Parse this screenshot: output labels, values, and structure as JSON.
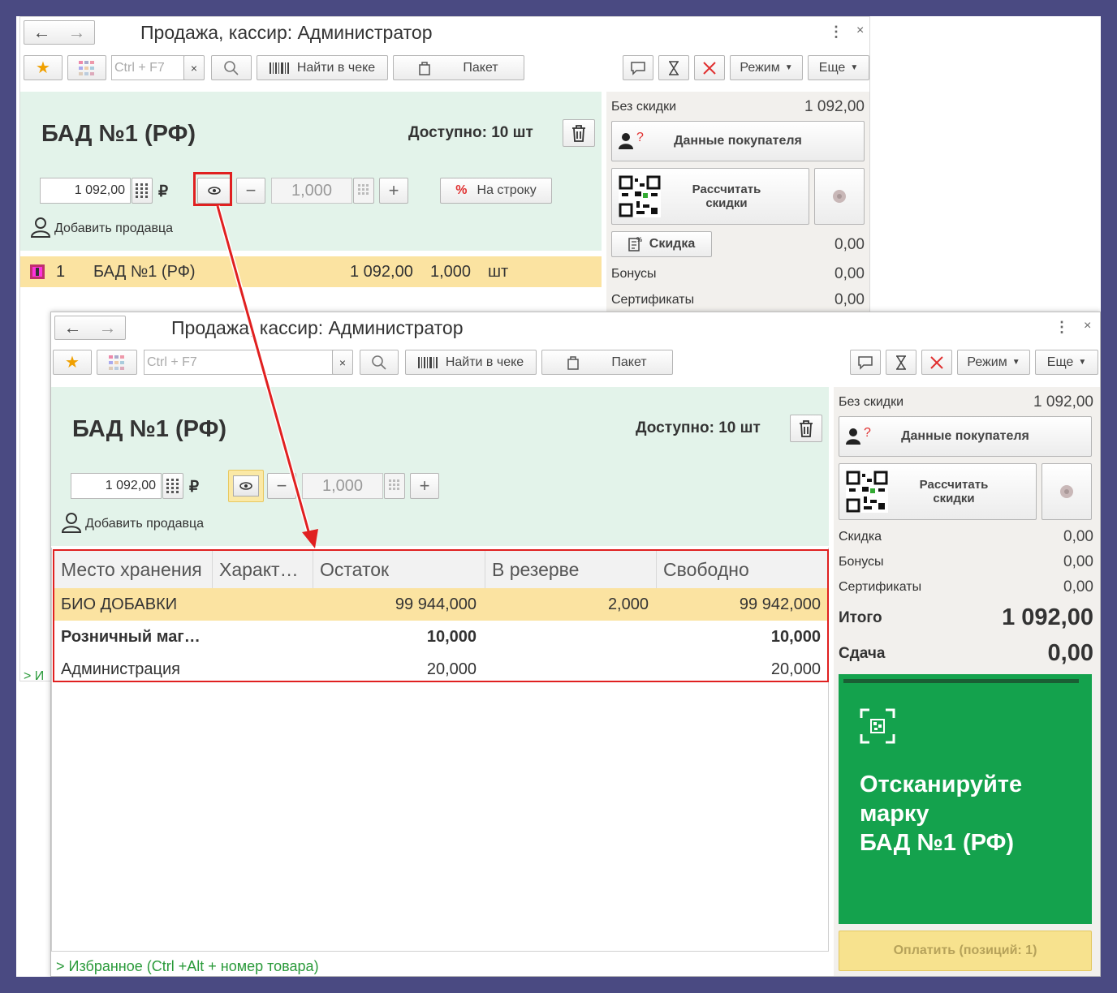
{
  "window": {
    "title": "Продажа, кассир: Администратор"
  },
  "toolbar": {
    "search_placeholder": "Ctrl + F7",
    "clear_label": "×",
    "find_in_receipt_label": "Найти в чеке",
    "package_label": "Пакет",
    "mode_label": "Режим",
    "more_label": "Еще",
    "more_menu": "⋮",
    "close": "×"
  },
  "product": {
    "name": "БАД №1 (РФ)",
    "available": "Доступно: 10 шт",
    "price": "1 092,00",
    "currency": "₽",
    "quantity": "1,000",
    "add_seller": "Добавить продавца",
    "per_line_label": "На строку",
    "percent_symbol": "%"
  },
  "receipt_line": {
    "index": "1",
    "name": "БАД №1 (РФ)",
    "price": "1 092,00",
    "qty": "1,000",
    "unit": "шт"
  },
  "summary": {
    "no_discount_label": "Без скидки",
    "no_discount_value": "1 092,00",
    "customer_data_label": "Данные покупателя",
    "calc_discounts_line1": "Рассчитать",
    "calc_discounts_line2": "скидки",
    "discount_label": "Скидка",
    "discount_value": "0,00",
    "bonuses_label": "Бонусы",
    "bonuses_value": "0,00",
    "certificates_label": "Сертификаты",
    "certificates_value": "0,00",
    "total_label": "Итого",
    "total_value": "1 092,00",
    "change_label": "Сдача",
    "change_value": "0,00"
  },
  "stock_table": {
    "headers": [
      "Место хранения",
      "Характ…",
      "Остаток",
      "В резерве",
      "Свободно"
    ],
    "rows": [
      {
        "place": "БИО ДОБАВКИ",
        "char": "",
        "balance": "99 944,000",
        "reserved": "2,000",
        "free": "99 942,000",
        "bold": false,
        "selected": true
      },
      {
        "place": "Розничный маг…",
        "char": "",
        "balance": "10,000",
        "reserved": "",
        "free": "10,000",
        "bold": true,
        "selected": false
      },
      {
        "place": "Администрация",
        "char": "",
        "balance": "20,000",
        "reserved": "",
        "free": "20,000",
        "bold": false,
        "selected": false
      }
    ]
  },
  "scan_panel": {
    "line1": "Отсканируйте",
    "line2": "марку",
    "line3": "БАД №1 (РФ)"
  },
  "pay_button": "Оплатить (позиций: 1)",
  "favorites": "Избранное (Ctrl +Alt + номер товара)",
  "favorites_partial": "> И",
  "colors": {
    "page_bg": "#4a4a82",
    "green_panel": "#e3f3ea",
    "selected_row": "#fbe3a1",
    "scan_green": "#14a24d",
    "highlight_red": "#e02020",
    "pay_yellow": "#f7e28e"
  }
}
